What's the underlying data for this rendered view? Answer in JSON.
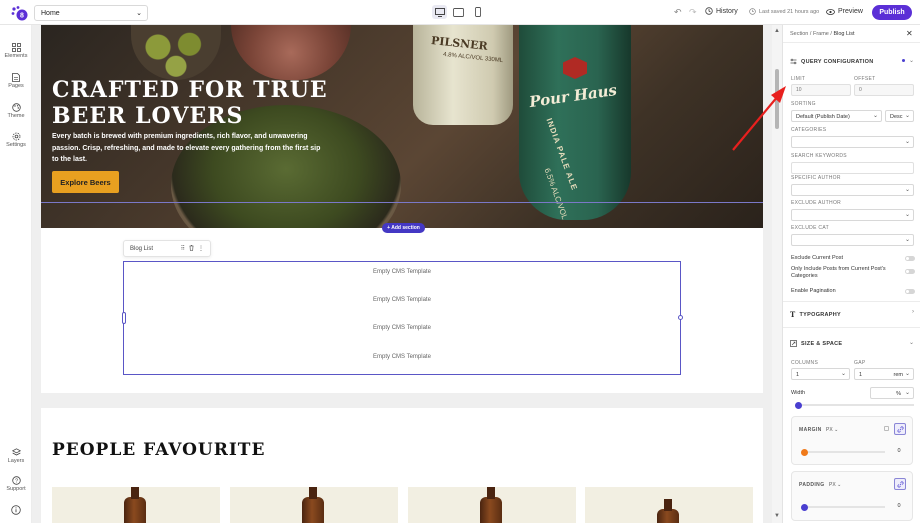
{
  "topbar": {
    "page_selector": "Home",
    "history_label": "History",
    "saved_status": "Last saved 21 hours ago",
    "preview_label": "Preview",
    "publish_label": "Publish",
    "devices": [
      "desktop-icon",
      "tablet-icon",
      "mobile-icon"
    ],
    "active_device": "desktop-icon"
  },
  "leftbar": {
    "items": [
      {
        "label": "Elements",
        "icon": "grid-icon"
      },
      {
        "label": "Pages",
        "icon": "page-icon"
      },
      {
        "label": "Theme",
        "icon": "palette-icon"
      },
      {
        "label": "Settings",
        "icon": "gear-icon"
      }
    ],
    "bottom": [
      {
        "label": "Layers",
        "icon": "layers-icon"
      },
      {
        "label": "Support",
        "icon": "help-icon"
      },
      {
        "label": "",
        "icon": "info-icon"
      }
    ]
  },
  "canvas": {
    "hero": {
      "title_line1": "CRAFTED FOR TRUE",
      "title_line2": "BEER LOVERS",
      "text": "Every batch is brewed with premium ingredients, rich flavor, and unwavering passion. Crisp, refreshing, and made to elevate every gathering from the first sip to the last.",
      "button": "Explore Beers",
      "bottle1_label": "PILSNER",
      "bottle1_sub": "4.8% ALC/VOL 330ML",
      "bottle2_label": "Pour Haus",
      "bottle2_style": "INDIA PALE ALE",
      "bottle2_abv": "6.5% ALC/VOL"
    },
    "add_section": "+ Add section",
    "blog": {
      "label": "Blog List",
      "items": [
        "Empty CMS Template",
        "Empty CMS Template",
        "Empty CMS Template",
        "Empty CMS Template"
      ]
    },
    "favourites_title": "PEOPLE FAVOURITE"
  },
  "panel": {
    "breadcrumb": [
      "Section",
      "Frame",
      "Blog List"
    ],
    "query": {
      "title": "QUERY CONFIGURATION",
      "limit_label": "LIMIT",
      "limit_placeholder": "10",
      "offset_label": "OFFSET",
      "offset_placeholder": "0",
      "sorting_label": "SORTING",
      "sorting_value": "Default (Publish Date)",
      "sorting_order": "Desc",
      "categories_label": "CATEGORIES",
      "search_label": "SEARCH KEYWORDS",
      "author_label": "SPECIFIC AUTHOR",
      "exclude_author_label": "EXCLUDE AUTHOR",
      "exclude_cat_label": "EXCLUDE CAT",
      "toggles": [
        {
          "label": "Exclude Current Post",
          "on": false
        },
        {
          "label": "Only Include Posts from Current Post's Categories",
          "on": false
        },
        {
          "label": "Enable Pagination",
          "on": false
        }
      ]
    },
    "typography": {
      "title": "TYPOGRAPHY"
    },
    "size_space": {
      "title": "SIZE & SPACE",
      "columns_label": "COLUMNS",
      "columns_value": "1",
      "gap_label": "GAP",
      "gap_value": "1",
      "gap_unit": "rem",
      "width_label": "Width",
      "width_unit": "%",
      "margin_label": "MARGIN",
      "margin_unit": "PX",
      "margin_value": "0",
      "padding_label": "PADDING",
      "padding_unit": "PX",
      "padding_value": "0"
    },
    "colors": {
      "accent": "#5b2fd6",
      "margin_knob": "#f07a1a",
      "padding_knob": "#4a3fd0"
    }
  }
}
